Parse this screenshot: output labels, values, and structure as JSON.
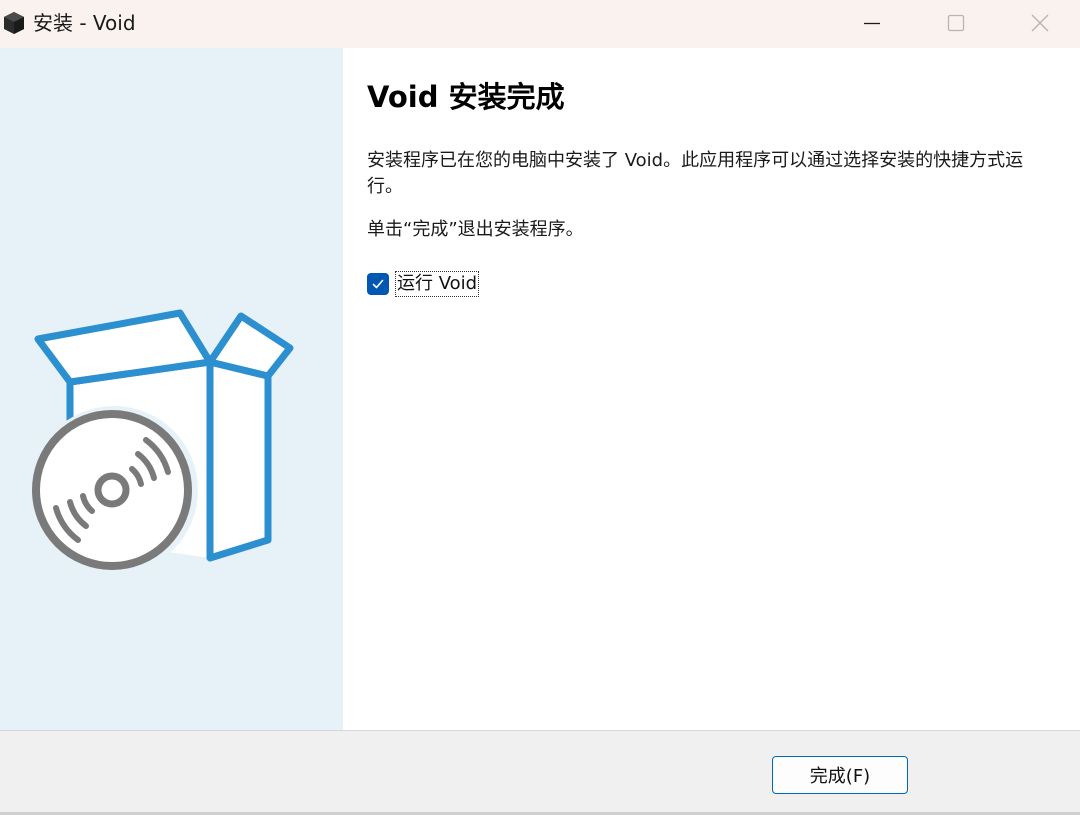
{
  "window": {
    "title": "安装 - Void"
  },
  "titlebar": {
    "icons": {
      "app": "void-cube-icon",
      "minimize": "minimize-icon",
      "maximize": "maximize-icon",
      "close": "close-icon"
    }
  },
  "sidebar": {
    "art": "software-box-with-disc-illustration",
    "background_color": "#e7f1f8",
    "accent_color": "#2b8fd0",
    "disc_color": "#7a7a7a"
  },
  "content": {
    "heading": "Void 安装完成",
    "paragraph1": "安装程序已在您的电脑中安装了 Void。此应用程序可以通过选择安装的快捷方式运行。",
    "paragraph2": "单击“完成”退出安装程序。",
    "run_checkbox": {
      "label": "运行 Void",
      "checked": true,
      "color": "#0058b3"
    }
  },
  "footer": {
    "finish_label": "完成(F)",
    "finish_border_color": "#0067c0"
  }
}
